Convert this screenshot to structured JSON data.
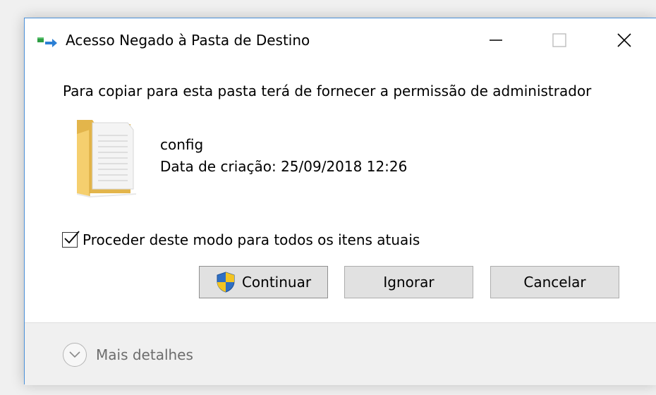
{
  "window": {
    "title": "Acesso Negado à Pasta de Destino",
    "accent_color": "#4a90d9"
  },
  "controls": {
    "minimize_icon": "minimize-icon",
    "maximize_icon": "maximize-icon",
    "close_icon": "close-icon"
  },
  "dialog": {
    "instruction": "Para copiar para esta pasta terá de fornecer a permissão de administrador",
    "item": {
      "name": "config",
      "created": "Data de criação: 25/09/2018 12:26",
      "icon": "folder-icon"
    },
    "apply_all": {
      "label": "Proceder deste modo para todos os itens atuais",
      "checked": true
    },
    "buttons": {
      "continue": "Continuar",
      "ignore": "Ignorar",
      "cancel": "Cancelar"
    }
  },
  "footer": {
    "more_details": "Mais detalhes"
  }
}
